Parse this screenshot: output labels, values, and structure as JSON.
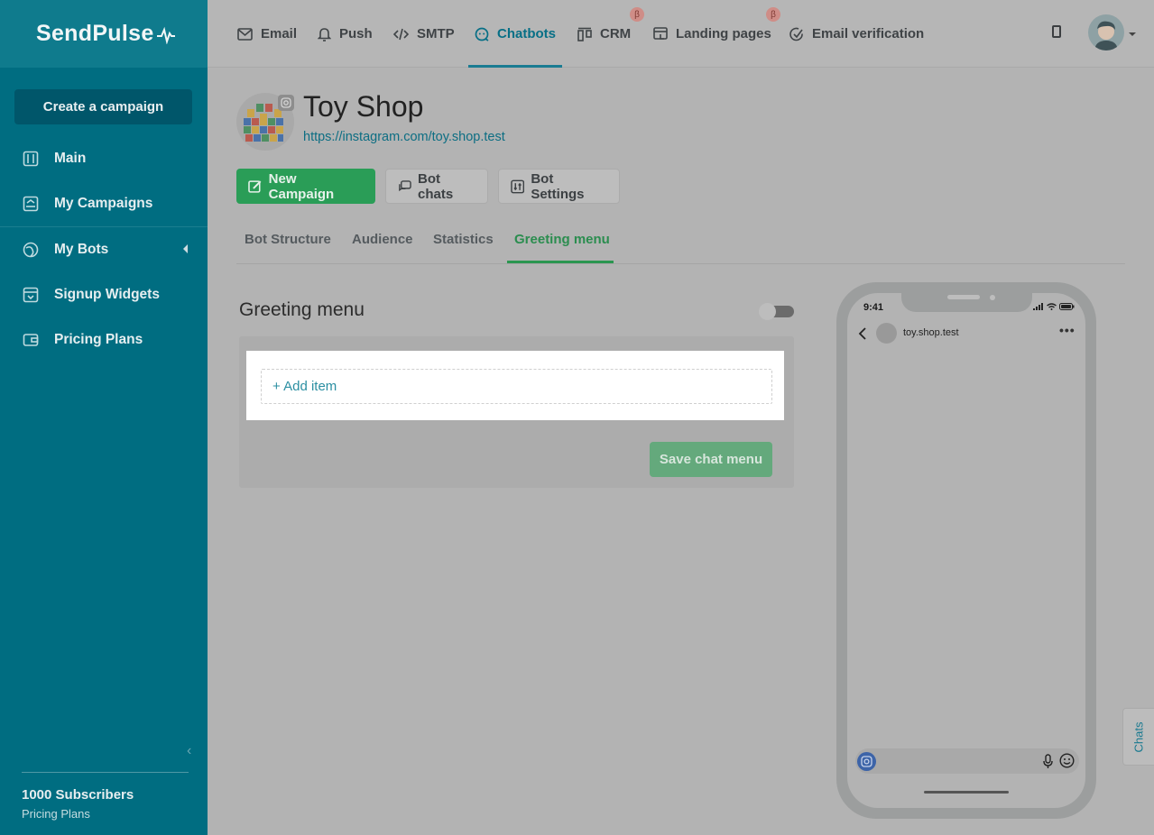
{
  "sidebar": {
    "logo": "SendPulse",
    "create_campaign": "Create a campaign",
    "items": [
      {
        "label": "Main",
        "icon": "dashboard-icon"
      },
      {
        "label": "My Campaigns",
        "icon": "campaigns-icon"
      },
      {
        "label": "My Bots",
        "icon": "bots-icon"
      },
      {
        "label": "Signup Widgets",
        "icon": "widget-icon"
      },
      {
        "label": "Pricing Plans",
        "icon": "wallet-icon"
      }
    ],
    "subscribers": "1000 Subscribers",
    "pricing_link": "Pricing Plans"
  },
  "topbar": {
    "tabs": [
      {
        "label": "Email",
        "icon": "mail-icon"
      },
      {
        "label": "Push",
        "icon": "bell-icon"
      },
      {
        "label": "SMTP",
        "icon": "code-icon"
      },
      {
        "label": "Chatbots",
        "icon": "chatbot-icon",
        "active": true
      },
      {
        "label": "CRM",
        "icon": "crm-icon",
        "beta": "β"
      },
      {
        "label": "Landing pages",
        "icon": "landing-icon",
        "beta": "β"
      },
      {
        "label": "Email verification",
        "icon": "check-circle-icon"
      }
    ]
  },
  "bot": {
    "name": "Toy Shop",
    "link": "https://instagram.com/toy.shop.test"
  },
  "actions": {
    "new_campaign": "New Campaign",
    "bot_chats": "Bot chats",
    "bot_settings": "Bot Settings"
  },
  "subtabs": [
    {
      "label": "Bot Structure"
    },
    {
      "label": "Audience"
    },
    {
      "label": "Statistics"
    },
    {
      "label": "Greeting menu",
      "active": true
    }
  ],
  "greeting": {
    "title": "Greeting menu",
    "add_item": "+ Add item",
    "save": "Save chat menu",
    "toggle_on": false
  },
  "phone": {
    "time": "9:41",
    "username": "toy.shop.test"
  },
  "chats_tab": "Chats",
  "colors": {
    "sidebar": "#006d81",
    "accent_green": "#2a9d57",
    "accent_teal": "#076f86"
  }
}
